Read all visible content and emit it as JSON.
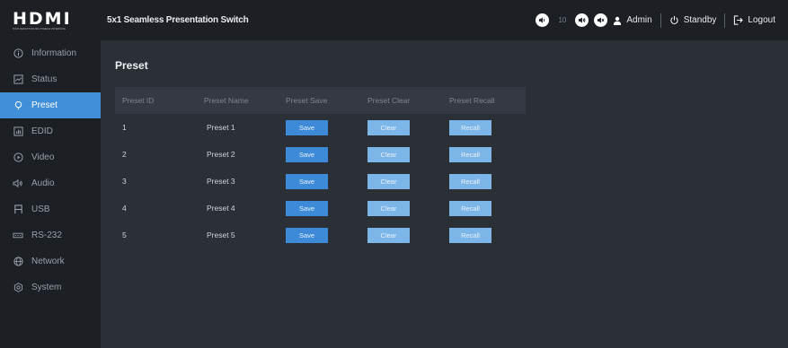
{
  "brand": {
    "logo": "HDMI",
    "logo_sub": "HIGH-DEFINITION MULTIMEDIA INTERFACE"
  },
  "header": {
    "product_name": "5x1 Seamless Presentation Switch",
    "volume": "10",
    "user": "Admin",
    "standby": "Standby",
    "logout": "Logout"
  },
  "sidebar": {
    "items": [
      {
        "label": "Information",
        "icon": "info-icon"
      },
      {
        "label": "Status",
        "icon": "status-icon"
      },
      {
        "label": "Preset",
        "icon": "preset-icon",
        "active": true
      },
      {
        "label": "EDID",
        "icon": "edid-icon"
      },
      {
        "label": "Video",
        "icon": "video-icon"
      },
      {
        "label": "Audio",
        "icon": "audio-icon"
      },
      {
        "label": "USB",
        "icon": "usb-icon"
      },
      {
        "label": "RS-232",
        "icon": "rs232-icon"
      },
      {
        "label": "Network",
        "icon": "network-icon"
      },
      {
        "label": "System",
        "icon": "system-icon"
      }
    ]
  },
  "main": {
    "title": "Preset",
    "columns": [
      "Preset ID",
      "Preset Name",
      "Preset Save",
      "Preset Clear",
      "Preset Recall"
    ],
    "rows": [
      {
        "id": "1",
        "name": "Preset 1",
        "save": "Save",
        "clear": "Clear",
        "recall": "Recall"
      },
      {
        "id": "2",
        "name": "Preset 2",
        "save": "Save",
        "clear": "Clear",
        "recall": "Recall"
      },
      {
        "id": "3",
        "name": "Preset 3",
        "save": "Save",
        "clear": "Clear",
        "recall": "Recall"
      },
      {
        "id": "4",
        "name": "Preset 4",
        "save": "Save",
        "clear": "Clear",
        "recall": "Recall"
      },
      {
        "id": "5",
        "name": "Preset 5",
        "save": "Save",
        "clear": "Clear",
        "recall": "Recall"
      }
    ]
  },
  "colors": {
    "accent": "#3f8fd9",
    "save_button": "#3d8ad8",
    "secondary_button": "#7cb6e8",
    "sidebar_bg": "#1c1f24",
    "content_bg": "#2b2f36"
  }
}
